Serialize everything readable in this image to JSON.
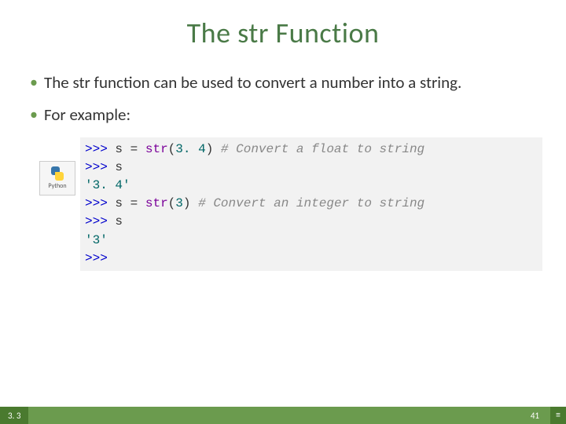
{
  "title": "The str Function",
  "bullets": [
    "The str function can be used to convert a number into a string.",
    "For example:"
  ],
  "python_badge_label": "Python",
  "code": {
    "l1_prompt": ">>>",
    "l1_var": "s",
    "l1_eq": "=",
    "l1_fn": "str",
    "l1_open": "(",
    "l1_arg": "3. 4",
    "l1_close": ")",
    "l1_comment": "# Convert a float to string",
    "l2_prompt": ">>>",
    "l2_var": "s",
    "l3_out": "'3. 4'",
    "l4_prompt": ">>>",
    "l4_var": "s",
    "l4_eq": "=",
    "l4_fn": "str",
    "l4_open": "(",
    "l4_arg": "3",
    "l4_close": ")",
    "l4_comment": "# Convert an integer to string",
    "l5_prompt": ">>>",
    "l5_var": "s",
    "l6_out": "'3'",
    "l7_prompt": ">>>"
  },
  "footer": {
    "section": "3. 3",
    "page": "41",
    "menu_glyph": "≡"
  }
}
